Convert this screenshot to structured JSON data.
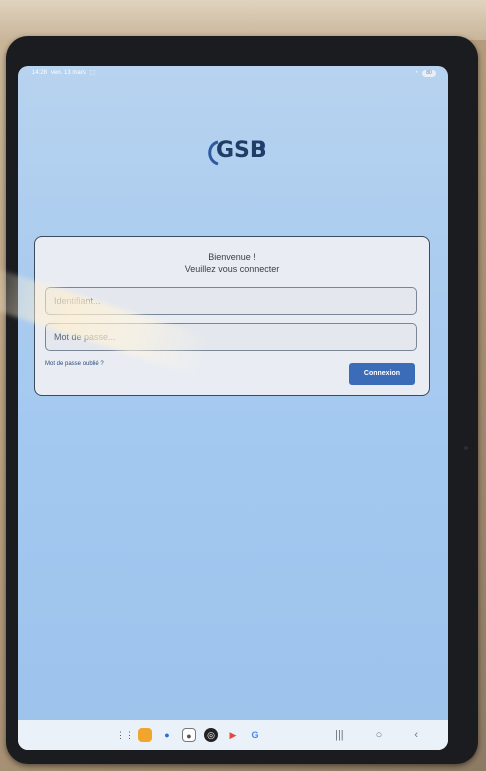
{
  "status_bar": {
    "time": "14:28",
    "date": "ven. 13 mars",
    "battery": "80"
  },
  "logo": {
    "text": "GSB"
  },
  "login": {
    "welcome_line1": "Bienvenue !",
    "welcome_line2": "Veuillez vous connecter",
    "username_placeholder": "Identifiant...",
    "password_placeholder": "Mot de passe...",
    "forgot_label": "Mot de passe oublié ?",
    "submit_label": "Connexion"
  },
  "taskbar": {
    "apps": [
      "apps-grid-icon",
      "folder-icon",
      "messages-icon",
      "screen-recorder-icon",
      "chrome-icon",
      "play-store-icon",
      "google-icon"
    ],
    "nav": [
      "recents-icon",
      "home-icon",
      "back-icon"
    ]
  },
  "colors": {
    "brand": "#1f3d66",
    "button": "#3b6cb7",
    "screen_bg": "#a9cbef"
  }
}
